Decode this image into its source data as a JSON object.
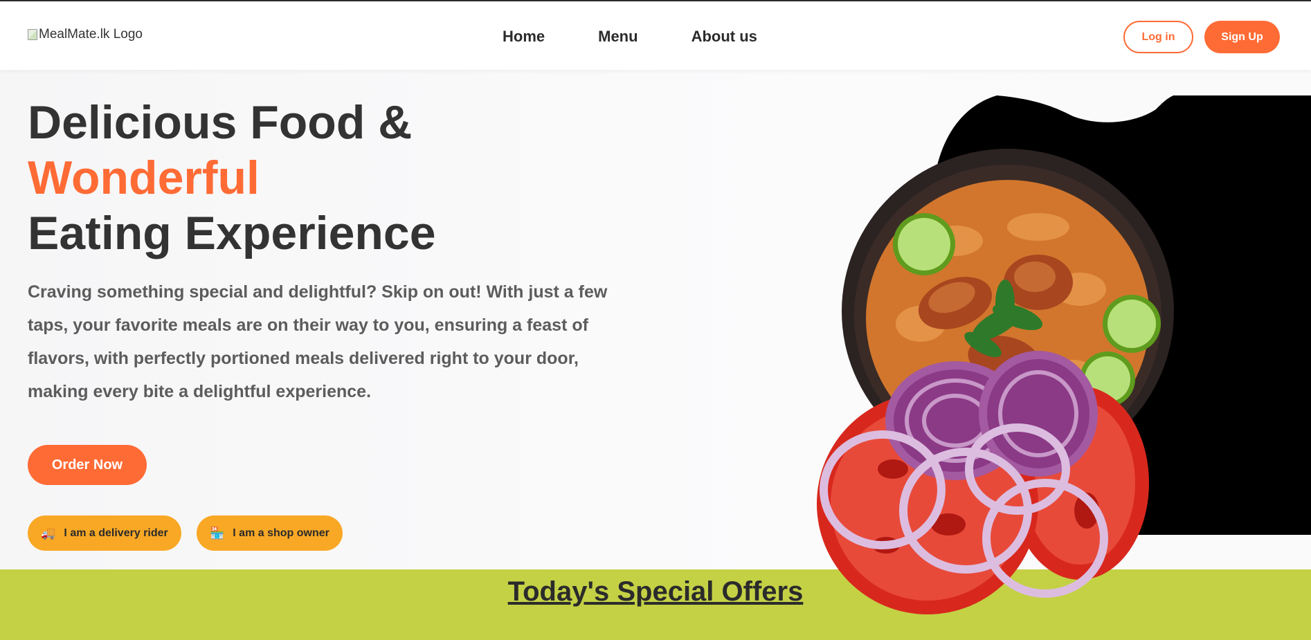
{
  "header": {
    "logo_alt": "MealMate.lk Logo",
    "nav": [
      {
        "label": "Home"
      },
      {
        "label": "Menu"
      },
      {
        "label": "About us"
      }
    ],
    "login_label": "Log in",
    "signup_label": "Sign Up"
  },
  "hero": {
    "title_line1": "Delicious Food &",
    "title_line2": "Wonderful",
    "title_line3": "Eating Experience",
    "description": "Craving something special and delightful? Skip on out! With just a few taps, your favorite meals are on their way to you, ensuring a feast of flavors, with perfectly portioned meals delivered right to your door, making every bite a delightful experience.",
    "order_label": "Order Now",
    "rider_icon": "🚚",
    "rider_label": "I am a delivery rider",
    "owner_icon": "🏪",
    "owner_label": "I am a shop owner",
    "image_description": "bowl of biryani with chicken, lime, basil, onion and tomato slices"
  },
  "offers": {
    "title": "Today's Special Offers"
  },
  "colors": {
    "accent": "#ff6b35",
    "role_button": "#f9a825",
    "offers_band": "#c4d145",
    "text_dark": "#333333"
  }
}
